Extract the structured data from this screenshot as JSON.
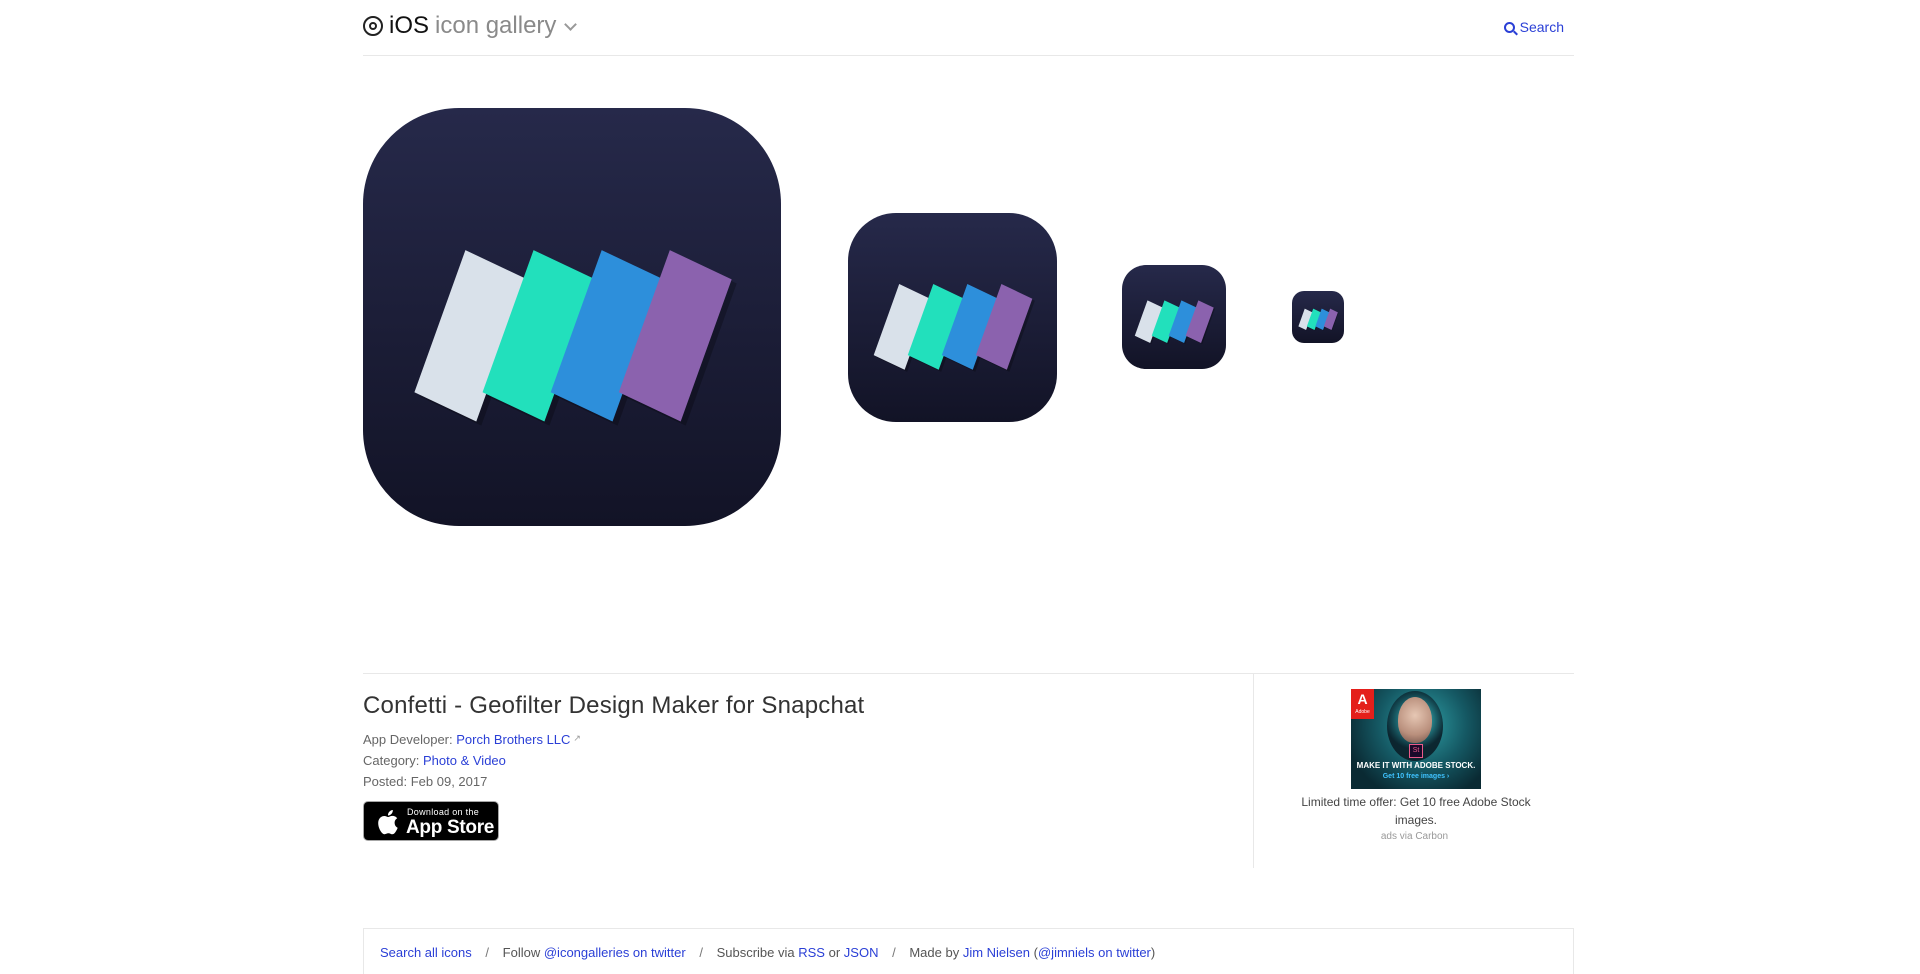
{
  "header": {
    "brand_ios": "iOS",
    "brand_gallery": "icon gallery",
    "search_label": "Search"
  },
  "icons": {
    "colors": {
      "background_top": "#26294a",
      "background_bottom": "#121326",
      "stripe_1": "#d9e1ea",
      "stripe_2": "#22e0bc",
      "stripe_3": "#2d8fdb",
      "stripe_4": "#8b62ae"
    }
  },
  "app": {
    "title": "Confetti - Geofilter Design Maker for Snapchat",
    "developer_label": "App Developer:",
    "developer": "Porch Brothers LLC",
    "category_label": "Category:",
    "category": "Photo & Video",
    "posted_label": "Posted:",
    "posted": "Feb 09, 2017",
    "appstore_small": "Download on the",
    "appstore_big": "App Store"
  },
  "ad": {
    "brand": "Adobe",
    "badge": "St",
    "headline": "MAKE IT WITH ADOBE STOCK.",
    "cta": "Get 10 free images ›",
    "copy": "Limited time offer: Get 10 free Adobe Stock images.",
    "via": "ads via Carbon"
  },
  "footer": {
    "search_all": "Search all icons",
    "follow_prefix": "Follow",
    "follow_link": "@icongalleries on twitter",
    "subscribe_prefix": "Subscribe via",
    "rss": "RSS",
    "or": "or",
    "json": "JSON",
    "made_by_prefix": "Made by",
    "author": "Jim Nielsen",
    "author_twitter": "@jimniels on twitter",
    "paren_open": "(",
    "paren_close": ")",
    "separator": "/"
  }
}
